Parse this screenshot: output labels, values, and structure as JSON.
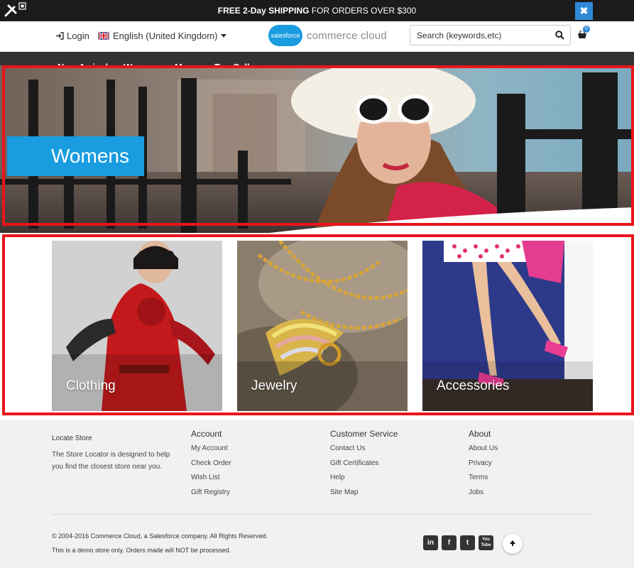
{
  "promo": {
    "bold": "FREE 2-Day SHIPPING",
    "rest": " FOR ORDERS OVER $300",
    "close": "✖"
  },
  "header": {
    "login": "Login",
    "locale": "English (United Kingdom)",
    "brand_badge": "salesforce",
    "brand_name": "commerce cloud",
    "search_placeholder": "Search (keywords,etc)",
    "cart_count": "0"
  },
  "nav": {
    "items": [
      "New Arrivals",
      "Womens",
      "Mens",
      "Top Sellers"
    ]
  },
  "hero": {
    "title": "Womens"
  },
  "categories": [
    {
      "label": "Clothing"
    },
    {
      "label": "Jewelry"
    },
    {
      "label": "Accessories"
    }
  ],
  "footer": {
    "locate": {
      "heading": "Locate Store",
      "text": "The Store Locator is designed to help you find the closest store near you."
    },
    "account": {
      "heading": "Account",
      "links": [
        "My Account",
        "Check Order",
        "Wish List",
        "Gift Registry"
      ]
    },
    "service": {
      "heading": "Customer Service",
      "links": [
        "Contact Us",
        "Gift Certificates",
        "Help",
        "Site Map"
      ]
    },
    "about": {
      "heading": "About",
      "links": [
        "About Us",
        "Privacy",
        "Terms",
        "Jobs"
      ]
    },
    "copyright": "© 2004-2016 Commerce Cloud, a Salesforce company. All Rights Reserved.",
    "demo_note": "This is a demo store only. Orders made will NOT be processed.",
    "social": [
      "in",
      "f",
      "t",
      "You Tube"
    ]
  },
  "colors": {
    "accent": "#1a9ce0",
    "highlight_frame": "#e8141c",
    "dark": "#333333"
  }
}
